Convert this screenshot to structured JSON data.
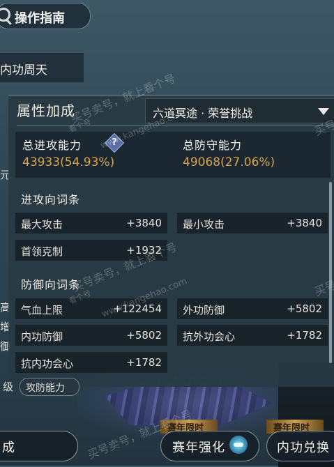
{
  "top_button": {
    "label": "操作指南"
  },
  "skill_tab": {
    "label": "内功周天"
  },
  "panel": {
    "title": "属性加成",
    "dropdown": {
      "selected": "六道冥途 · 荣誉挑战"
    },
    "totals": {
      "attack_label": "总进攻能力",
      "attack_help": "?",
      "attack_value": "43933(54.93%)",
      "defense_label": "总防守能力",
      "defense_value": "49068(27.06%)"
    },
    "attack_section": {
      "title": "进攻向词条",
      "stats": [
        {
          "name": "最大攻击",
          "value": "+3840"
        },
        {
          "name": "最小攻击",
          "value": "+3840"
        },
        {
          "name": "首领克制",
          "value": "+1932"
        }
      ]
    },
    "defense_section": {
      "title": "防御向词条",
      "stats": [
        {
          "name": "气血上限",
          "value": "+122454"
        },
        {
          "name": "外功防御",
          "value": "+5802"
        },
        {
          "name": "内功防御",
          "value": "+5802"
        },
        {
          "name": "抗外功会心",
          "value": "+1782"
        },
        {
          "name": "抗内功会心",
          "value": "+1782"
        }
      ]
    }
  },
  "left_fragments": {
    "mid": "元",
    "gao": "高",
    "zeng": "增",
    "yu": "御",
    "level": "级",
    "bottom_left": "成"
  },
  "attack_chip": {
    "label": "攻防能力"
  },
  "bottom": {
    "badge1": "赛年限时",
    "badge2": "赛年限时",
    "btn1_label": "赛年强化",
    "btn2_label": "内功兑换"
  },
  "watermarks": [
    "买号卖号，就上看个号",
    "www.kangehao.com",
    "看个号",
    "买号卖号，就上看个号",
    "www.kangehao.com",
    "看个号",
    "买号卖号，就上看个号",
    "买号",
    "买号"
  ]
}
